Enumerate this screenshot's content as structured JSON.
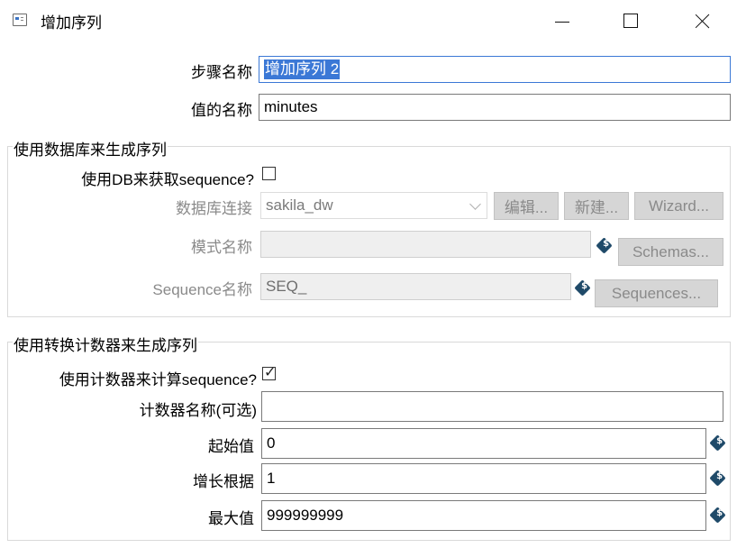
{
  "window": {
    "title": "增加序列",
    "controls": {
      "minimize": "minimize",
      "maximize": "maximize",
      "close": "close"
    }
  },
  "step": {
    "name_label": "步骤名称",
    "name_value": "增加序列 2",
    "value_name_label": "值的名称",
    "value_name_value": "minutes"
  },
  "db_group": {
    "title": "使用数据库来生成序列",
    "use_db_label": "使用DB来获取sequence?",
    "use_db_checked": false,
    "connection_label": "数据库连接",
    "connection_value": "sakila_dw",
    "edit_button": "编辑...",
    "new_button": "新建...",
    "wizard_button": "Wizard...",
    "schema_label": "模式名称",
    "schema_value": "",
    "schemas_button": "Schemas...",
    "sequence_label": "Sequence名称",
    "sequence_value": "SEQ_",
    "sequences_button": "Sequences..."
  },
  "counter_group": {
    "title": "使用转换计数器来生成序列",
    "use_counter_label": "使用计数器来计算sequence?",
    "use_counter_checked": true,
    "check_mark": "✓",
    "counter_name_label": "计数器名称(可选)",
    "counter_name_value": "",
    "start_label": "起始值",
    "start_value": "0",
    "increment_label": "增长根据",
    "increment_value": "1",
    "max_label": "最大值",
    "max_value": "999999999"
  },
  "colors": {
    "selection": "#3b78d6",
    "variable_icon": "#1f4a69",
    "disabled_button": "#d6d6d6"
  }
}
